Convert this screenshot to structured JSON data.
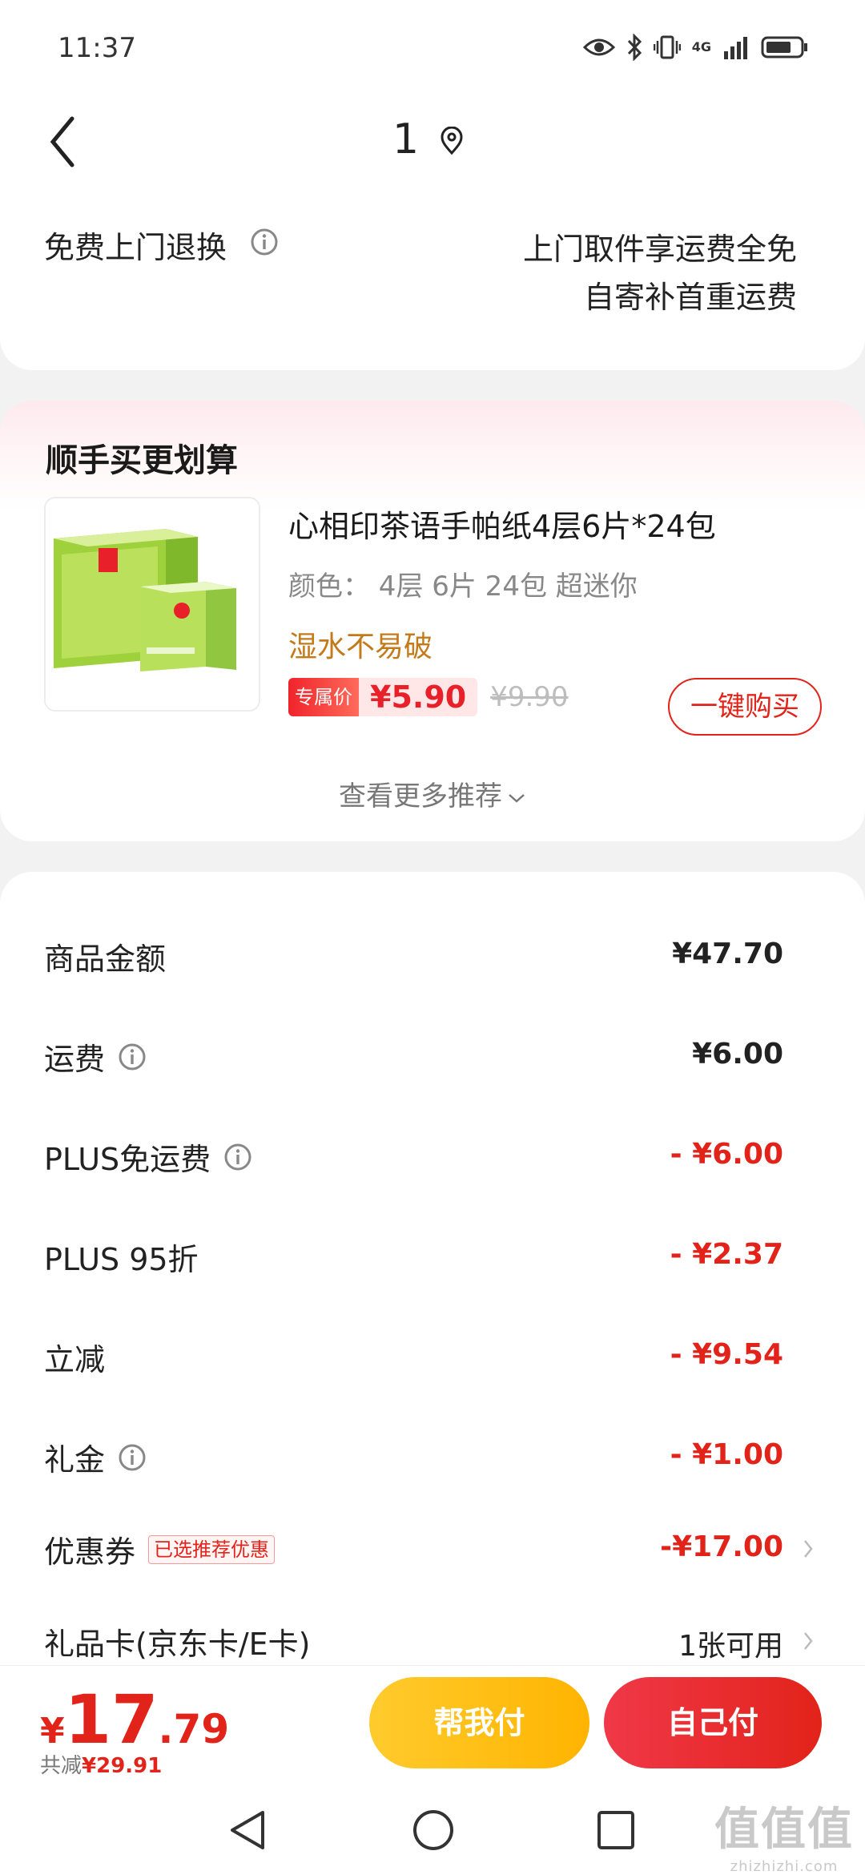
{
  "status": {
    "time": "11:37",
    "network": "4G"
  },
  "header": {
    "title": "1"
  },
  "returns": {
    "label": "免费上门退换",
    "line1": "上门取件享运费全免",
    "line2": "自寄补首重运费"
  },
  "recommend": {
    "title": "顺手买更划算",
    "product": {
      "name": "心相印茶语手帕纸4层6片*24包",
      "spec": "颜色：  4层 6片 24包 超迷你",
      "tag": "湿水不易破",
      "badge": "专属价",
      "price": "¥5.90",
      "old_price": "¥9.90",
      "buy_label": "一键购买"
    },
    "more_label": "查看更多推荐"
  },
  "summary": {
    "rows": [
      {
        "label": "商品金额",
        "value": "¥47.70"
      },
      {
        "label": "运费",
        "value": "¥6.00"
      },
      {
        "label": "PLUS免运费",
        "value": "- ¥6.00"
      },
      {
        "label": "PLUS 95折",
        "value": "- ¥2.37"
      },
      {
        "label": "立减",
        "value": "- ¥9.54"
      },
      {
        "label": "礼金",
        "value": "- ¥1.00"
      },
      {
        "label": "优惠券",
        "tag": "已选推荐优惠",
        "value": "-¥17.00"
      },
      {
        "label": "礼品卡(京东卡/E卡)",
        "value": "1张可用"
      }
    ]
  },
  "bottom": {
    "currency": "¥",
    "total_int": "17",
    "total_dec": ".79",
    "discount_label": "共减",
    "discount_value": "¥29.91",
    "help_pay": "帮我付",
    "self_pay": "自己付"
  },
  "watermark": {
    "big": "值值值",
    "small": "zhizhizhi.com"
  },
  "colors": {
    "accent": "#e2231a",
    "help_btn": "#ffb400",
    "tag": "#c37a1a"
  }
}
